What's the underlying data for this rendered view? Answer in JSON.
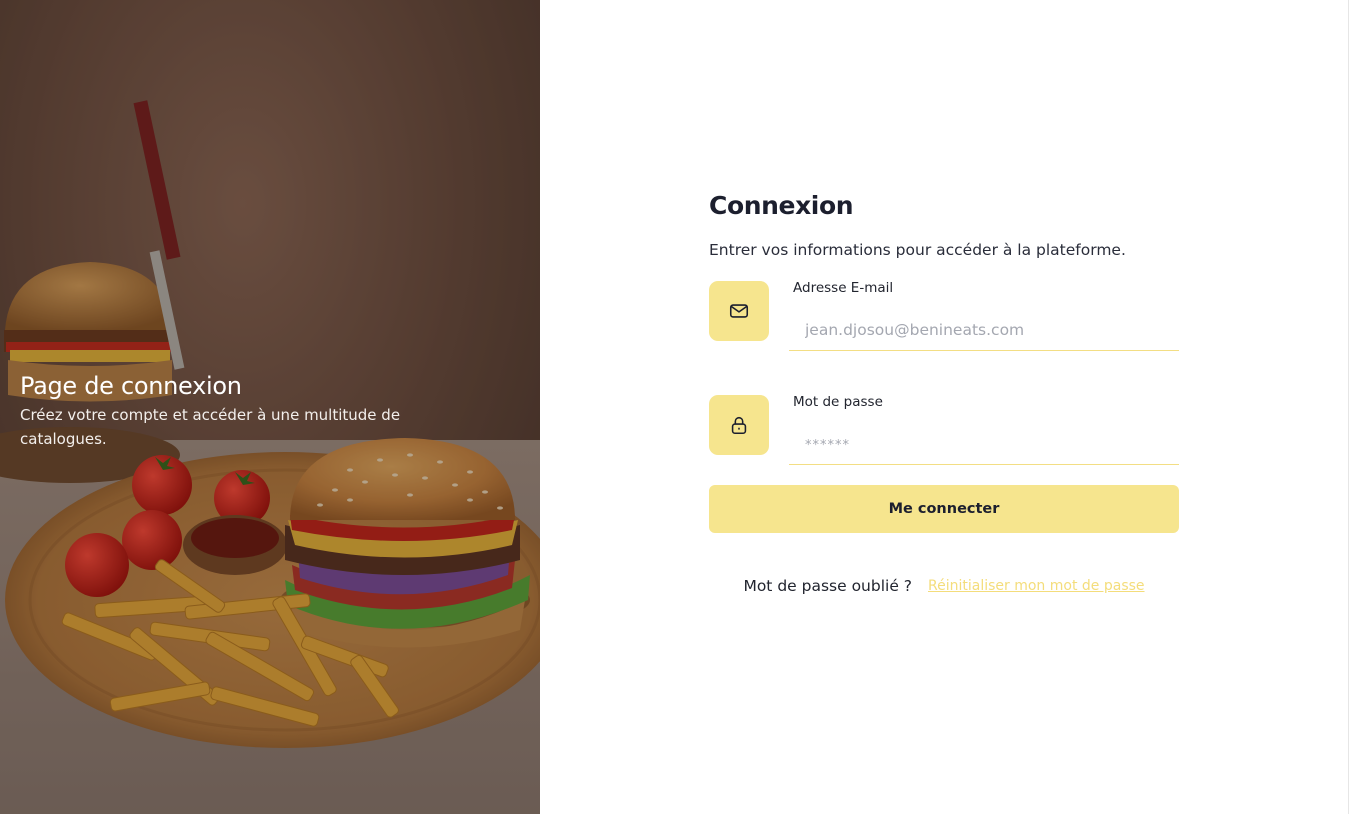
{
  "hero": {
    "title": "Page de connexion",
    "subtitle": "Créez votre compte et accéder à une multitude de catalogues."
  },
  "form": {
    "title": "Connexion",
    "subtitle": "Entrer vos informations pour accéder à la plateforme.",
    "email": {
      "label": "Adresse E-mail",
      "placeholder": "jean.djosou@benineats.com",
      "icon": "mail-icon"
    },
    "password": {
      "label": "Mot de passe",
      "placeholder": "******",
      "icon": "lock-icon"
    },
    "submit_label": "Me connecter",
    "forgot_text": "Mot de passe oublié ?",
    "reset_link": "Réinitialiser mon mot de passe"
  },
  "colors": {
    "accent": "#f6e58e",
    "link": "#f4dd7b",
    "text_dark": "#1c1f2e"
  }
}
